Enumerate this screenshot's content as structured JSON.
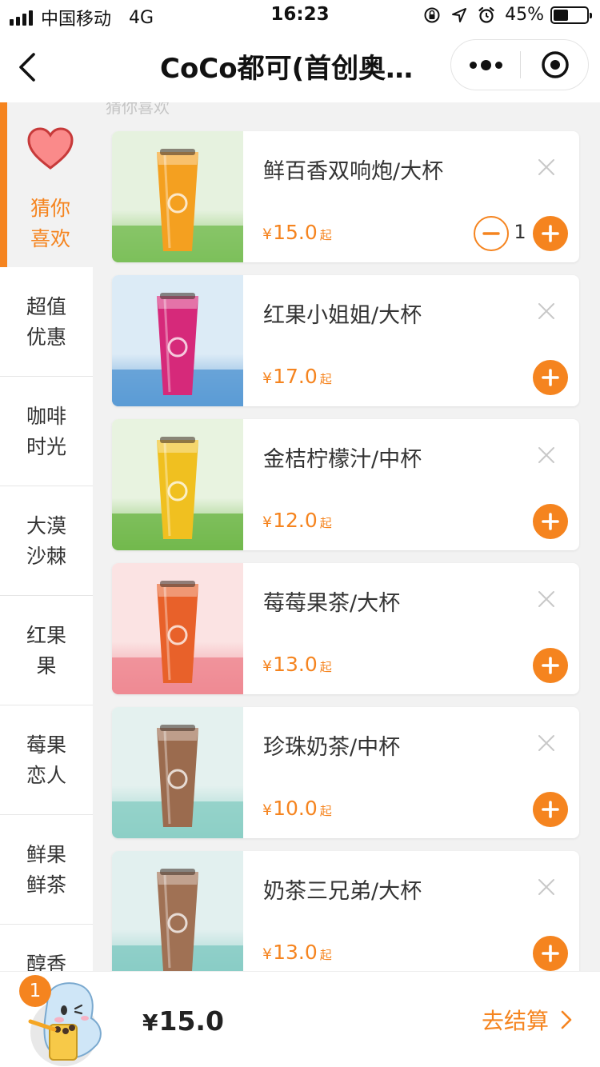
{
  "status_bar": {
    "carrier": "中国移动",
    "network": "4G",
    "time": "16:23",
    "battery": "45%"
  },
  "nav": {
    "title": "CoCo都可(首创奥…"
  },
  "sidebar": {
    "active": {
      "label": "猜你喜欢",
      "line1": "猜你",
      "line2": "喜欢"
    },
    "items": [
      {
        "line1": "超值",
        "line2": "优惠"
      },
      {
        "line1": "咖啡",
        "line2": "时光"
      },
      {
        "line1": "大漠",
        "line2": "沙棘"
      },
      {
        "line1": "红果",
        "line2": "果"
      },
      {
        "line1": "莓果",
        "line2": "恋人"
      },
      {
        "line1": "鲜果",
        "line2": "鲜茶"
      },
      {
        "line1": "醇香",
        "line2": ""
      }
    ]
  },
  "section_label": "猜你喜欢",
  "products": [
    {
      "name": "鲜百香双响炮/大杯",
      "price": "15.0",
      "qty": "1",
      "drink": "#f4a020",
      "bg_top": "#e6f2df",
      "bg_bottom": "#7cc05a"
    },
    {
      "name": "红果小姐姐/大杯",
      "price": "17.0",
      "qty": "",
      "drink": "#d6297a",
      "bg_top": "#dcebf6",
      "bg_bottom": "#5b9bd5"
    },
    {
      "name": "金桔柠檬汁/中杯",
      "price": "12.0",
      "qty": "",
      "drink": "#f0c020",
      "bg_top": "#e8f3e0",
      "bg_bottom": "#72b94c"
    },
    {
      "name": "莓莓果茶/大杯",
      "price": "13.0",
      "qty": "",
      "drink": "#e8612a",
      "bg_top": "#fbe3e3",
      "bg_bottom": "#ee8a93"
    },
    {
      "name": "珍珠奶茶/中杯",
      "price": "10.0",
      "qty": "",
      "drink": "#9b6b4e",
      "bg_top": "#e4f1ef",
      "bg_bottom": "#8ccfc6"
    },
    {
      "name": "奶茶三兄弟/大杯",
      "price": "13.0",
      "qty": "",
      "drink": "#a07154",
      "bg_top": "#e2f0ef",
      "bg_bottom": "#86cbc4"
    }
  ],
  "currency": "¥",
  "price_suffix": "起",
  "cart": {
    "count": "1",
    "total": "15.0",
    "checkout_label": "去结算"
  },
  "colors": {
    "accent": "#f5841f"
  },
  "icons": {
    "back": "chevron-left-icon",
    "more": "more-dots-icon",
    "close": "target-close-icon",
    "remove": "x-icon",
    "add": "plus-icon",
    "minus": "minus-icon",
    "heart": "heart-icon",
    "checkout": "chevron-right-icon"
  }
}
